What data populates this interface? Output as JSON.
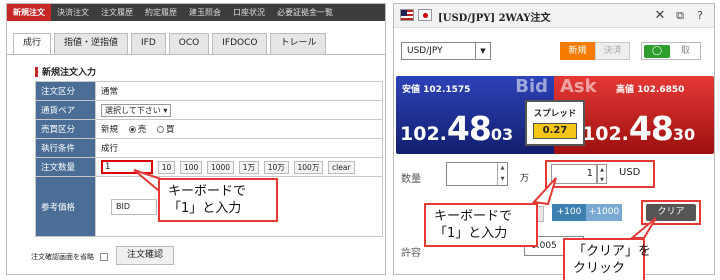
{
  "topnav": {
    "items": [
      "新規注文",
      "決済注文",
      "注文履歴",
      "約定履歴",
      "建玉照会",
      "口座状況",
      "必要証拠金一覧"
    ]
  },
  "order_tabs": [
    "成行",
    "指値・逆指値",
    "IFD",
    "OCO",
    "IFDOCO",
    "トレール"
  ],
  "form": {
    "title": "新規注文入力",
    "rows": {
      "order_type_label": "注文区分",
      "order_type_value": "通常",
      "pair_label": "通貨ペア",
      "pair_select": "選択して下さい",
      "side_label": "売買区分",
      "side_new": "新規",
      "side_sell": "売",
      "side_buy": "買",
      "cond_label": "執行条件",
      "cond_value": "成行",
      "qty_label": "注文数量",
      "qty_value": "1",
      "qty_buttons": [
        "10",
        "100",
        "1000",
        "1万",
        "10万",
        "100万",
        "clear"
      ],
      "ref_label": "参考価格",
      "bid_label": "BID"
    },
    "skip_label": "注文確認画面を省略",
    "confirm_button": "注文確認"
  },
  "callouts": {
    "left": [
      "キーボードで",
      "「1」と入力"
    ],
    "right": [
      "キーボードで",
      "「1」と入力"
    ],
    "clear": [
      "「クリア」を",
      "クリック"
    ]
  },
  "twoway": {
    "title": "[USD/JPY] 2WAY注文",
    "pair": "USD/JPY",
    "new_label": "新規",
    "settle_label": "決済",
    "toggle_off": "取",
    "bid": {
      "low_label": "安値",
      "low_value": "102.1575",
      "side": "Bid",
      "big_head": "102.",
      "big_mid": "48",
      "big_tail": "03"
    },
    "ask": {
      "high_label": "高値",
      "high_value": "102.6850",
      "side": "Ask",
      "big_head": "102.",
      "big_mid": "48",
      "big_tail": "30"
    },
    "spread_label": "スプレッド",
    "spread_value": "0.27",
    "qty_label": "数量",
    "unit_man": "万",
    "qty_value": "1",
    "currency": "USD",
    "btn_100": "+100",
    "btn_1000": "+1000",
    "clear_button": "クリア",
    "allow_label": "許容",
    "allow_value": "0.005"
  },
  "colors": {
    "accent_red": "#c62828",
    "bid_blue": "#1f35a0",
    "ask_red": "#d32f2f",
    "label_blue": "#4a6e95",
    "spread_yellow": "#f5c518"
  }
}
